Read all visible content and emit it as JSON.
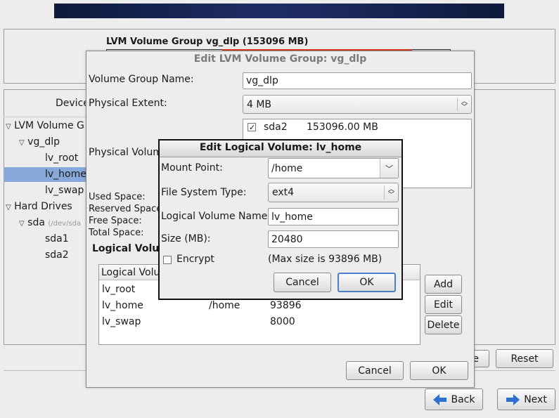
{
  "header": {
    "lvm_title": "LVM Volume Group vg_dlp (153096 MB)"
  },
  "tree": {
    "column_header": "Device",
    "items": [
      {
        "label": "LVM Volume G",
        "indent": 0,
        "expander": true
      },
      {
        "label": "vg_dlp",
        "indent": 1,
        "expander": true
      },
      {
        "label": "lv_root",
        "indent": 2
      },
      {
        "label": "lv_home",
        "indent": 2,
        "selected": true
      },
      {
        "label": "lv_swap",
        "indent": 2
      },
      {
        "label": "Hard Drives",
        "indent": 0,
        "expander": true
      },
      {
        "label": "sda",
        "sub": "(/dev/sda",
        "indent": 1,
        "expander": true
      },
      {
        "label": "sda1",
        "indent": 2
      },
      {
        "label": "sda2",
        "indent": 2
      }
    ]
  },
  "vg_dialog": {
    "title": "Edit LVM Volume Group: vg_dlp",
    "name_label": "Volume Group Name:",
    "name_value": "vg_dlp",
    "extent_label": "Physical Extent:",
    "extent_value": "4 MB",
    "pv_label": "Physical Volum",
    "pv_rows": [
      {
        "name": "sda2",
        "size": "153096.00 MB",
        "checked": true
      }
    ],
    "space_labels": [
      "Used Space:",
      "Reserved Space",
      "Free Space:",
      "Total Space:"
    ],
    "lv_section_label": "Logical Volu",
    "lv_table_header": "Logical Volu",
    "lv_rows": [
      {
        "name": "lv_root",
        "mount": "",
        "size": ""
      },
      {
        "name": "lv_home",
        "mount": "/home",
        "size": "93896"
      },
      {
        "name": "lv_swap",
        "mount": "",
        "size": "8000"
      }
    ],
    "add": "Add",
    "edit": "Edit",
    "delete": "Delete",
    "cancel": "Cancel",
    "ok": "OK"
  },
  "lv_dialog": {
    "title": "Edit Logical Volume: lv_home",
    "mount_label": "Mount Point:",
    "mount_value": "/home",
    "fs_label": "File System Type:",
    "fs_value": "ext4",
    "lvname_label": "Logical Volume Name:",
    "lvname_value": "lv_home",
    "size_label": "Size (MB):",
    "size_value": "20480",
    "encrypt_label": "Encrypt",
    "max_size": "(Max size is 93896 MB)",
    "cancel": "Cancel",
    "ok": "OK"
  },
  "main_buttons": {
    "partial": "e",
    "reset": "Reset"
  },
  "nav": {
    "back": "Back",
    "next": "Next"
  },
  "colors": {
    "selection": "#86a9d9",
    "banner": "#1f2d66",
    "bar_red": "#e03a1e",
    "arrow_blue": "#2e6fcf"
  }
}
